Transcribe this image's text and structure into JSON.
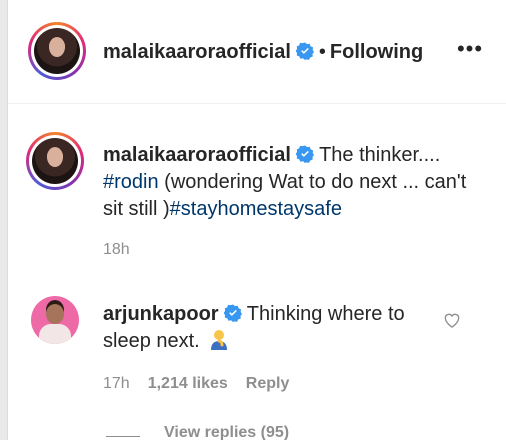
{
  "header": {
    "username": "malaikaaroraofficial",
    "separator": "•",
    "following_label": "Following",
    "more_label": "•••"
  },
  "caption": {
    "username": "malaikaaroraofficial",
    "text_part1": "The thinker....",
    "hashtag1": "#rodin",
    "text_part2": "(wondering Wat to do next ... can't sit still )",
    "hashtag2": "#stayhomestaysafe",
    "time": "18h"
  },
  "comment": {
    "username": "arjunkapoor",
    "text": "Thinking where to sleep next.",
    "time": "17h",
    "likes": "1,214 likes",
    "reply_label": "Reply"
  },
  "replies": {
    "label": "View replies (95)"
  },
  "colors": {
    "text": "#262626",
    "secondary": "#8e8e8e",
    "hashtag": "#00376b",
    "verified": "#3897f0"
  },
  "icons": {
    "verified": "verified-badge-icon",
    "more": "more-options-icon",
    "heart": "heart-outline-icon",
    "emoji": "person-thinking-emoji"
  }
}
